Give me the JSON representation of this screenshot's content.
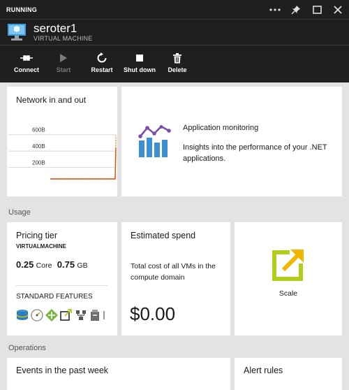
{
  "header": {
    "status": "RUNNING",
    "vm_name": "seroter1",
    "vm_type": "VIRTUAL MACHINE",
    "toolbar": [
      {
        "label": "Connect",
        "icon": "connect-icon",
        "enabled": true
      },
      {
        "label": "Start",
        "icon": "play-icon",
        "enabled": false
      },
      {
        "label": "Restart",
        "icon": "restart-icon",
        "enabled": true
      },
      {
        "label": "Shut down",
        "icon": "stop-icon",
        "enabled": true
      },
      {
        "label": "Delete",
        "icon": "trash-icon",
        "enabled": true
      }
    ],
    "window_controls": [
      "more-icon",
      "pin-icon",
      "maximize-icon",
      "close-icon"
    ]
  },
  "network": {
    "title": "Network in and out",
    "chart_data": {
      "type": "line",
      "y_ticks": [
        "600B",
        "400B",
        "200B"
      ],
      "ylim": [
        0,
        700
      ],
      "series": [
        {
          "color": "#e8a33a",
          "style": "dashed-baseline",
          "values": [
            0,
            0,
            0,
            0,
            0,
            0,
            0,
            0,
            0,
            0,
            0,
            0,
            0,
            0,
            0,
            0,
            0,
            0,
            0,
            0,
            0,
            0,
            0,
            0,
            0,
            0,
            0,
            0,
            0,
            0,
            0,
            0,
            0,
            0,
            0,
            0,
            0,
            0,
            0,
            0,
            0,
            0,
            0,
            0,
            0,
            0,
            0,
            0,
            0,
            0,
            0,
            0,
            0,
            0,
            0,
            0,
            0,
            0,
            0,
            0,
            0,
            0,
            0,
            0,
            0,
            0,
            0,
            0,
            0,
            0,
            0,
            0,
            0,
            0,
            0,
            0,
            0,
            0,
            0,
            0,
            0,
            0,
            0,
            0,
            0,
            0,
            0,
            0,
            0,
            0,
            530
          ]
        },
        {
          "color": "#d94f1e",
          "values": [
            0,
            0,
            0,
            0,
            0,
            0,
            0,
            0,
            0,
            0,
            0,
            0,
            0,
            0,
            0,
            0,
            0,
            0,
            0,
            0,
            0,
            0,
            0,
            0,
            0,
            0,
            0,
            0,
            0,
            0,
            0,
            0,
            0,
            0,
            0,
            0,
            0,
            0,
            0,
            0,
            0,
            0,
            0,
            0,
            0,
            0,
            0,
            0,
            0,
            0,
            0,
            0,
            0,
            0,
            0,
            0,
            0,
            0,
            0,
            0,
            0,
            0,
            0,
            0,
            0,
            0,
            0,
            0,
            0,
            0,
            0,
            0,
            0,
            0,
            0,
            0,
            0,
            0,
            0,
            0,
            0,
            0,
            0,
            0,
            0,
            0,
            0,
            0,
            0,
            0,
            0,
            0,
            0,
            380
          ]
        }
      ]
    }
  },
  "app_monitoring": {
    "title": "Application monitoring",
    "description": "Insights into the performance of your .NET applications.",
    "icon": "app-insights-icon"
  },
  "usage_label": "Usage",
  "pricing": {
    "title": "Pricing tier",
    "tier": "VIRTUALMACHINE",
    "cores_value": "0.25",
    "cores_unit": "Core",
    "memory_value": "0.75",
    "memory_unit": "GB",
    "features_label": "STANDARD FEATURES",
    "features": [
      "storage-icon",
      "speedometer-icon",
      "load-balancer-icon",
      "autoscale-icon",
      "network-icon",
      "backup-icon",
      "more-features-icon"
    ]
  },
  "spend": {
    "title": "Estimated spend",
    "description": "Total cost of all VMs in the compute domain",
    "amount": "$0.00"
  },
  "scale": {
    "label": "Scale",
    "icon": "scale-icon",
    "accent": "#b4cc1e",
    "arrow_color": "#f2b600"
  },
  "operations_label": "Operations",
  "events": {
    "title": "Events in the past week"
  },
  "alerts": {
    "title": "Alert rules"
  }
}
